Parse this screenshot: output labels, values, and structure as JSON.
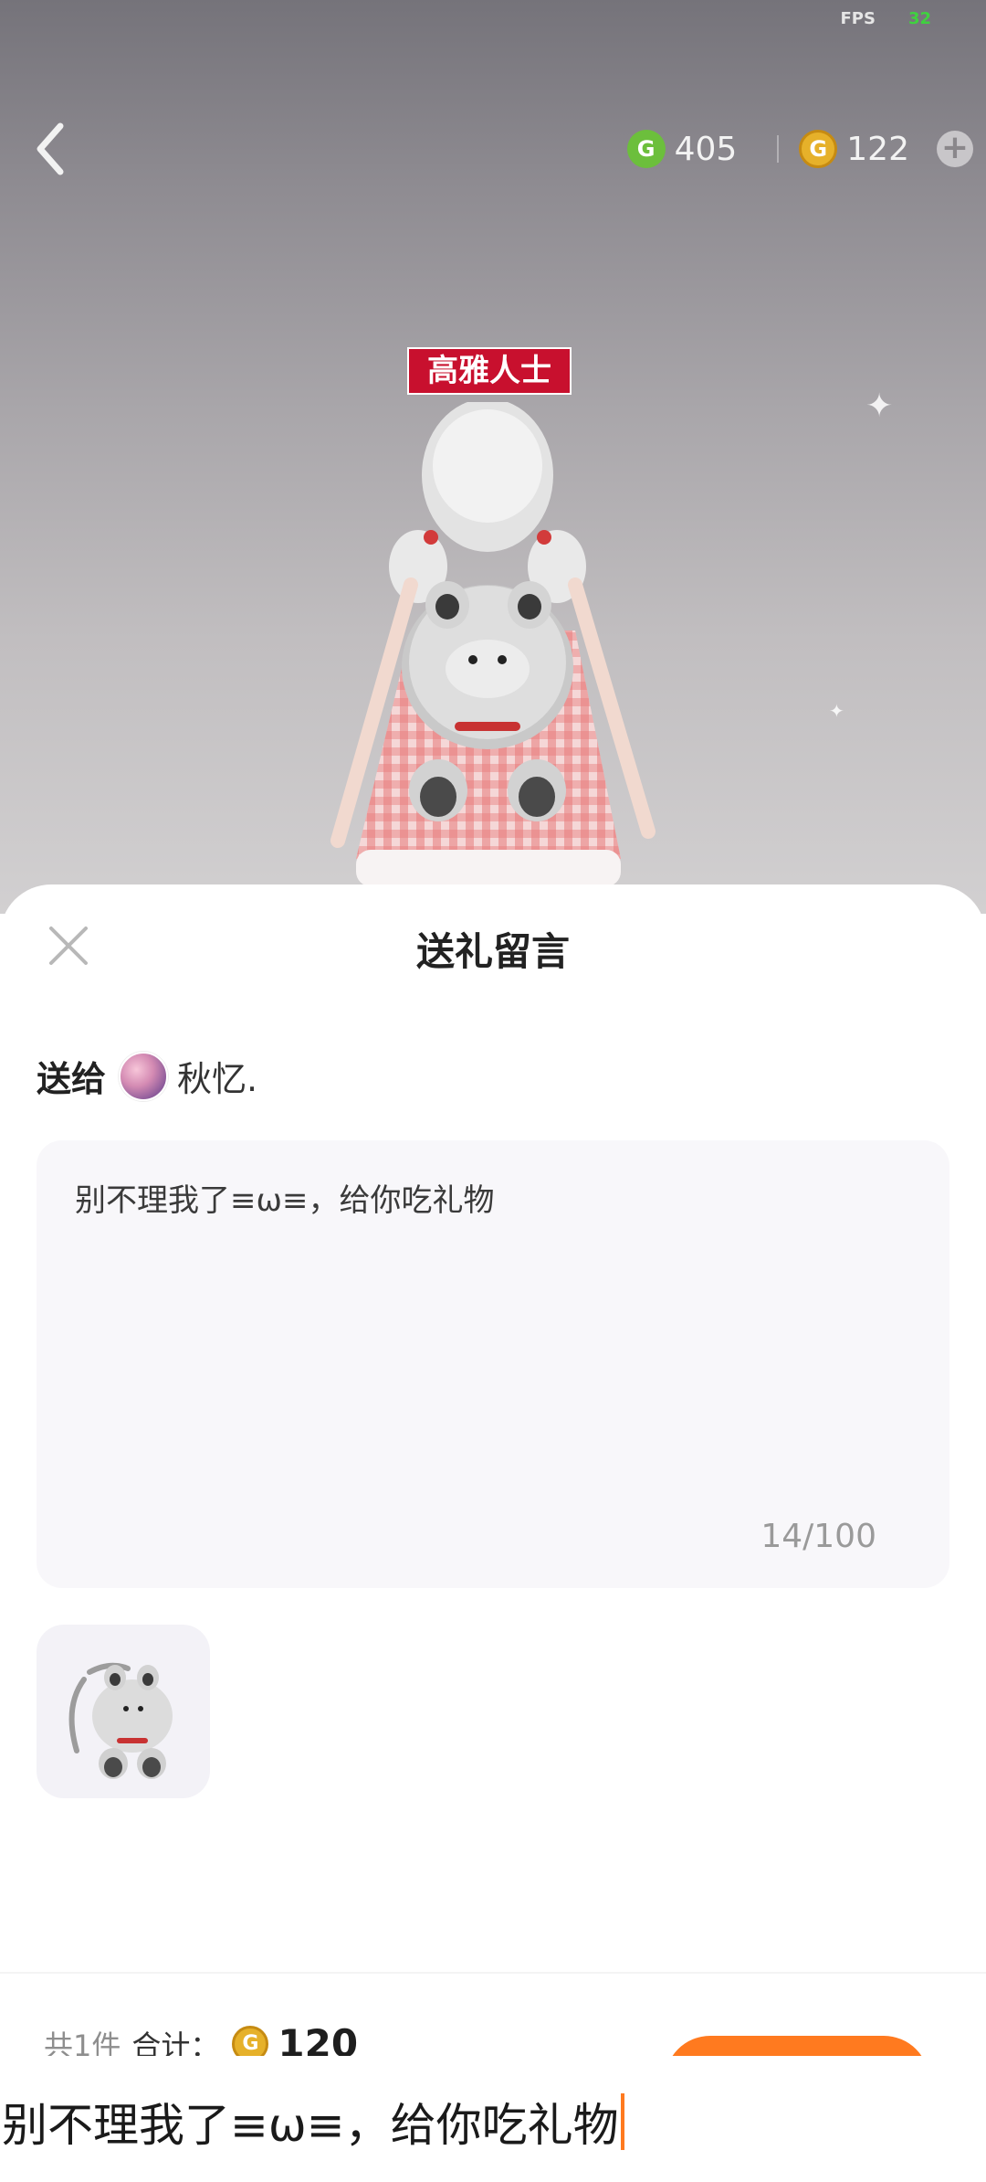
{
  "hud": {
    "fps_label": "FPS",
    "fps_value": "32",
    "green_currency": "405",
    "gold_currency": "122"
  },
  "scene": {
    "name_tag": "高雅人士"
  },
  "sheet": {
    "title": "送礼留言",
    "to_label": "送给",
    "recipient_name": "秋忆."
  },
  "message": {
    "text": "别不理我了≡ω≡，给你吃礼物",
    "counter": "14/100"
  },
  "summary": {
    "count_label": "共1件",
    "total_label": "合计：",
    "amount": "120"
  },
  "ime": {
    "composing_text": "别不理我了≡ω≡，给你吃礼物"
  },
  "colors": {
    "accent": "#ff7a1f",
    "green_coin": "#6cbf3c",
    "gold_coin": "#e6b12a",
    "tag_red": "#c8102e"
  }
}
